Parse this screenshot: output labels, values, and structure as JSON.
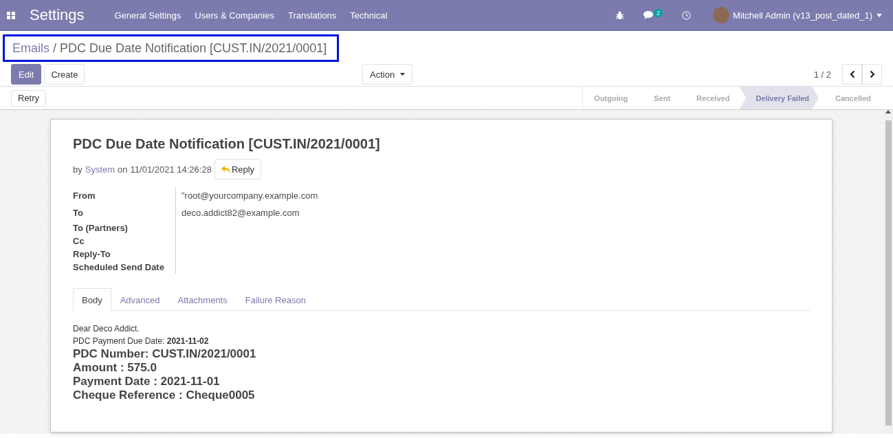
{
  "navbar": {
    "app_title": "Settings",
    "menu": [
      "General Settings",
      "Users & Companies",
      "Translations",
      "Technical"
    ],
    "messages_count": "2",
    "user": "Mitchell Admin (v13_post_dated_1)"
  },
  "breadcrumb": {
    "parent": "Emails",
    "separator": "/",
    "current": "PDC Due Date Notification [CUST.IN/2021/0001]"
  },
  "buttons": {
    "edit": "Edit",
    "create": "Create",
    "action": "Action"
  },
  "pager": {
    "value": "1 / 2"
  },
  "header_buttons": [
    "Retry"
  ],
  "stages": [
    {
      "label": "Outgoing",
      "selected": false
    },
    {
      "label": "Sent",
      "selected": false
    },
    {
      "label": "Received",
      "selected": false
    },
    {
      "label": "Delivery Failed",
      "selected": true
    },
    {
      "label": "Cancelled",
      "selected": false
    }
  ],
  "message": {
    "subject": "PDC Due Date Notification [CUST.IN/2021/0001]",
    "author_prefix": "by",
    "author": "System",
    "date_prefix": "on",
    "date": "11/01/2021 14:26:28",
    "reply": "Reply",
    "fields": [
      {
        "label": "From",
        "value": "\"root@yourcompany.example.com"
      },
      {
        "label": "To",
        "value": "deco.addict82@example.com"
      },
      {
        "label": "To (Partners)"
      },
      {
        "label": "Cc"
      },
      {
        "label": "Reply-To"
      },
      {
        "label": "Scheduled Send Date"
      }
    ],
    "tabs": [
      {
        "label": "Body",
        "selected": true
      },
      {
        "label": "Advanced",
        "selected": false
      },
      {
        "label": "Attachments",
        "selected": false
      },
      {
        "label": "Failure Reason",
        "selected": false
      }
    ],
    "body": [
      {
        "kind": "text",
        "text": "Dear Deco Addict."
      },
      {
        "kind": "text",
        "text": "PDC Payment Due Date: **2021-11-02**"
      },
      {
        "kind": "heading",
        "text": "PDC Number: CUST.IN/2021/0001"
      },
      {
        "kind": "heading",
        "text": "Amount : 575.0"
      },
      {
        "kind": "heading",
        "text": "Payment Date : 2021-11-01"
      },
      {
        "kind": "heading",
        "text": "Cheque Reference : Cheque0005"
      }
    ]
  }
}
